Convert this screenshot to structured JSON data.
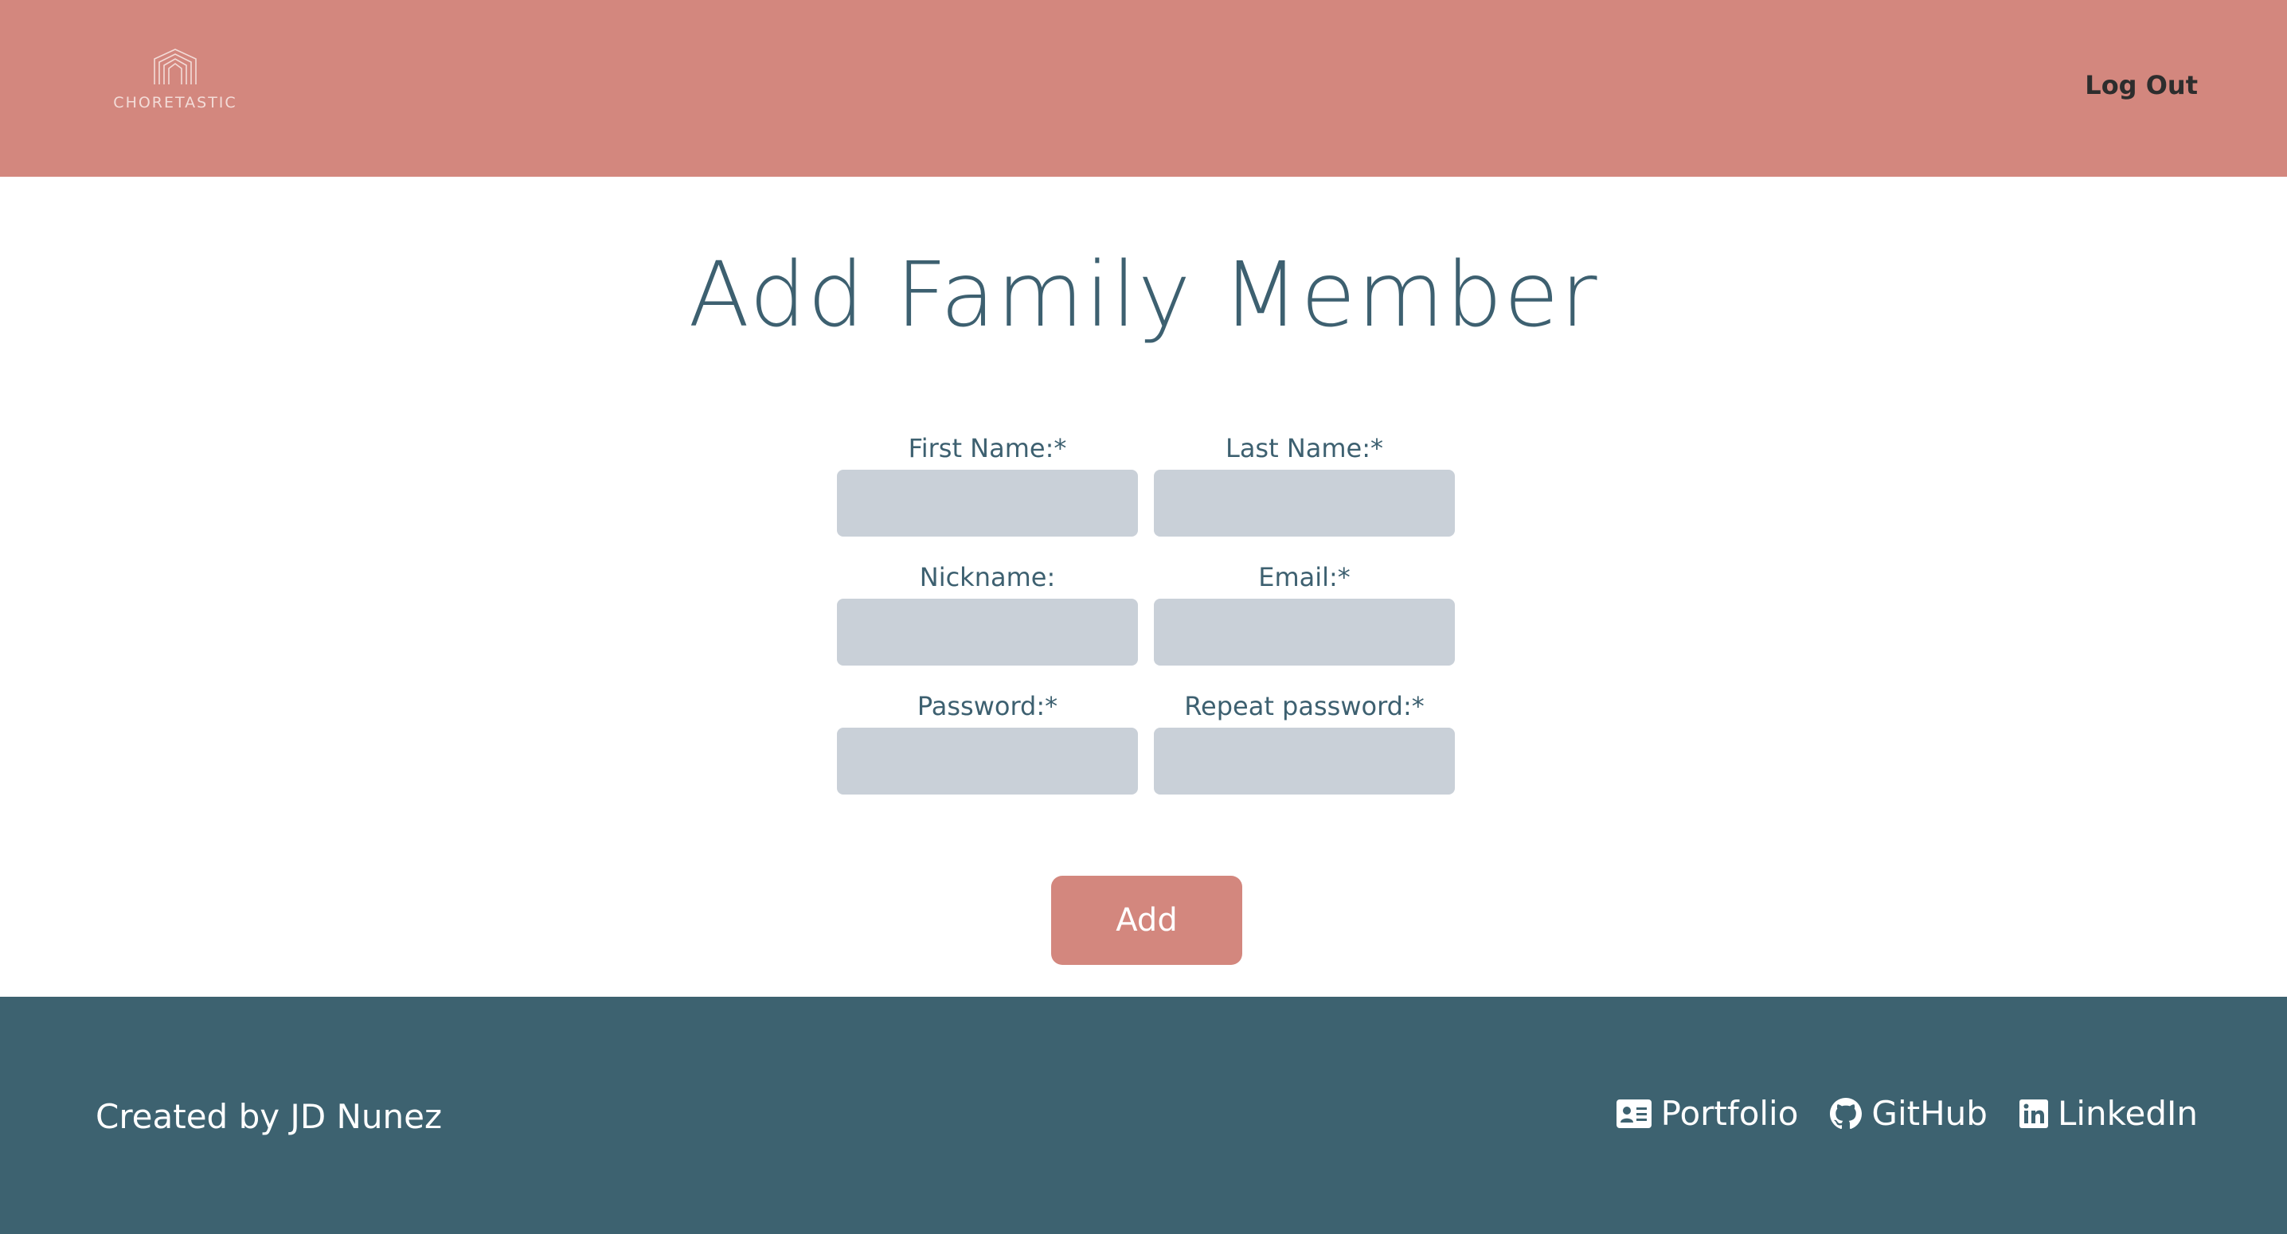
{
  "header": {
    "logo_text": "CHORETASTIC",
    "logout_label": "Log Out"
  },
  "main": {
    "title": "Add Family Member",
    "fields": [
      {
        "label": "First Name:*",
        "value": "",
        "placeholder": ""
      },
      {
        "label": "Last Name:*",
        "value": "",
        "placeholder": ""
      },
      {
        "label": "Nickname:",
        "value": "",
        "placeholder": ""
      },
      {
        "label": "Email:*",
        "value": "",
        "placeholder": ""
      },
      {
        "label": "Password:*",
        "value": "",
        "placeholder": ""
      },
      {
        "label": "Repeat password:*",
        "value": "",
        "placeholder": ""
      }
    ],
    "add_label": "Add"
  },
  "footer": {
    "credit": "Created by JD Nunez",
    "links": [
      {
        "label": "Portfolio",
        "icon": "id-card-icon"
      },
      {
        "label": "GitHub",
        "icon": "github-icon"
      },
      {
        "label": "LinkedIn",
        "icon": "linkedin-icon"
      }
    ]
  },
  "colors": {
    "header_bg": "#d3877e",
    "footer_bg": "#3d6270",
    "title_text": "#3d6070",
    "input_bg": "#c9d0d8",
    "button_bg": "#d3877e"
  }
}
